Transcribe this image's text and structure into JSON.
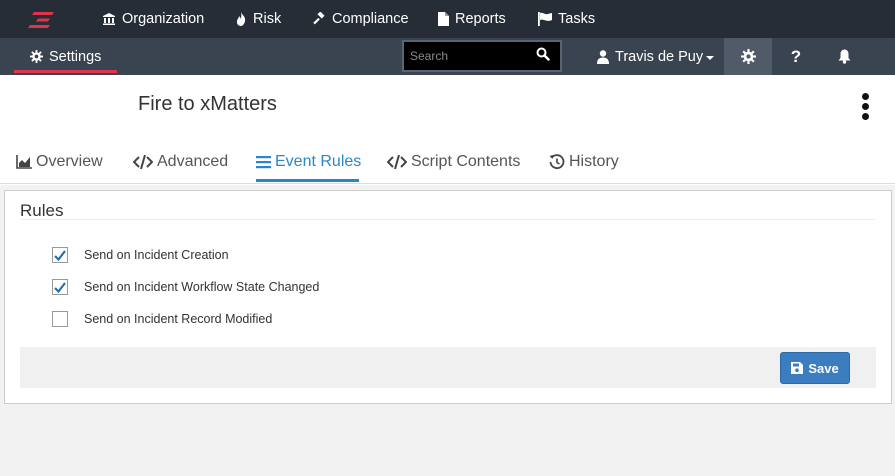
{
  "topnav": {
    "items": [
      {
        "label": "Organization",
        "icon": "bank-icon"
      },
      {
        "label": "Risk",
        "icon": "fire-icon"
      },
      {
        "label": "Compliance",
        "icon": "gavel-icon"
      },
      {
        "label": "Reports",
        "icon": "file-icon"
      },
      {
        "label": "Tasks",
        "icon": "flag-icon"
      }
    ]
  },
  "subbar": {
    "settings_label": "Settings",
    "search_placeholder": "Search",
    "user_name": "Travis de Puy",
    "help_label": "?"
  },
  "page": {
    "title": "Fire to xMatters",
    "tabs": [
      {
        "label": "Overview",
        "icon": "chart-icon"
      },
      {
        "label": "Advanced",
        "icon": "code-icon"
      },
      {
        "label": "Event Rules",
        "icon": "list-icon",
        "active": true
      },
      {
        "label": "Script Contents",
        "icon": "code-icon"
      },
      {
        "label": "History",
        "icon": "history-icon"
      }
    ]
  },
  "rules": {
    "title": "Rules",
    "items": [
      {
        "label": "Send on Incident Creation",
        "checked": true
      },
      {
        "label": "Send on Incident Workflow State Changed",
        "checked": true
      },
      {
        "label": "Send on Incident Record Modified",
        "checked": false
      }
    ],
    "save_label": "Save"
  },
  "colors": {
    "topbar": "#262d36",
    "subbar": "#3a4350",
    "accent_red": "#e0334c",
    "accent_blue": "#2a86c5",
    "save_button": "#3c7dbf"
  }
}
